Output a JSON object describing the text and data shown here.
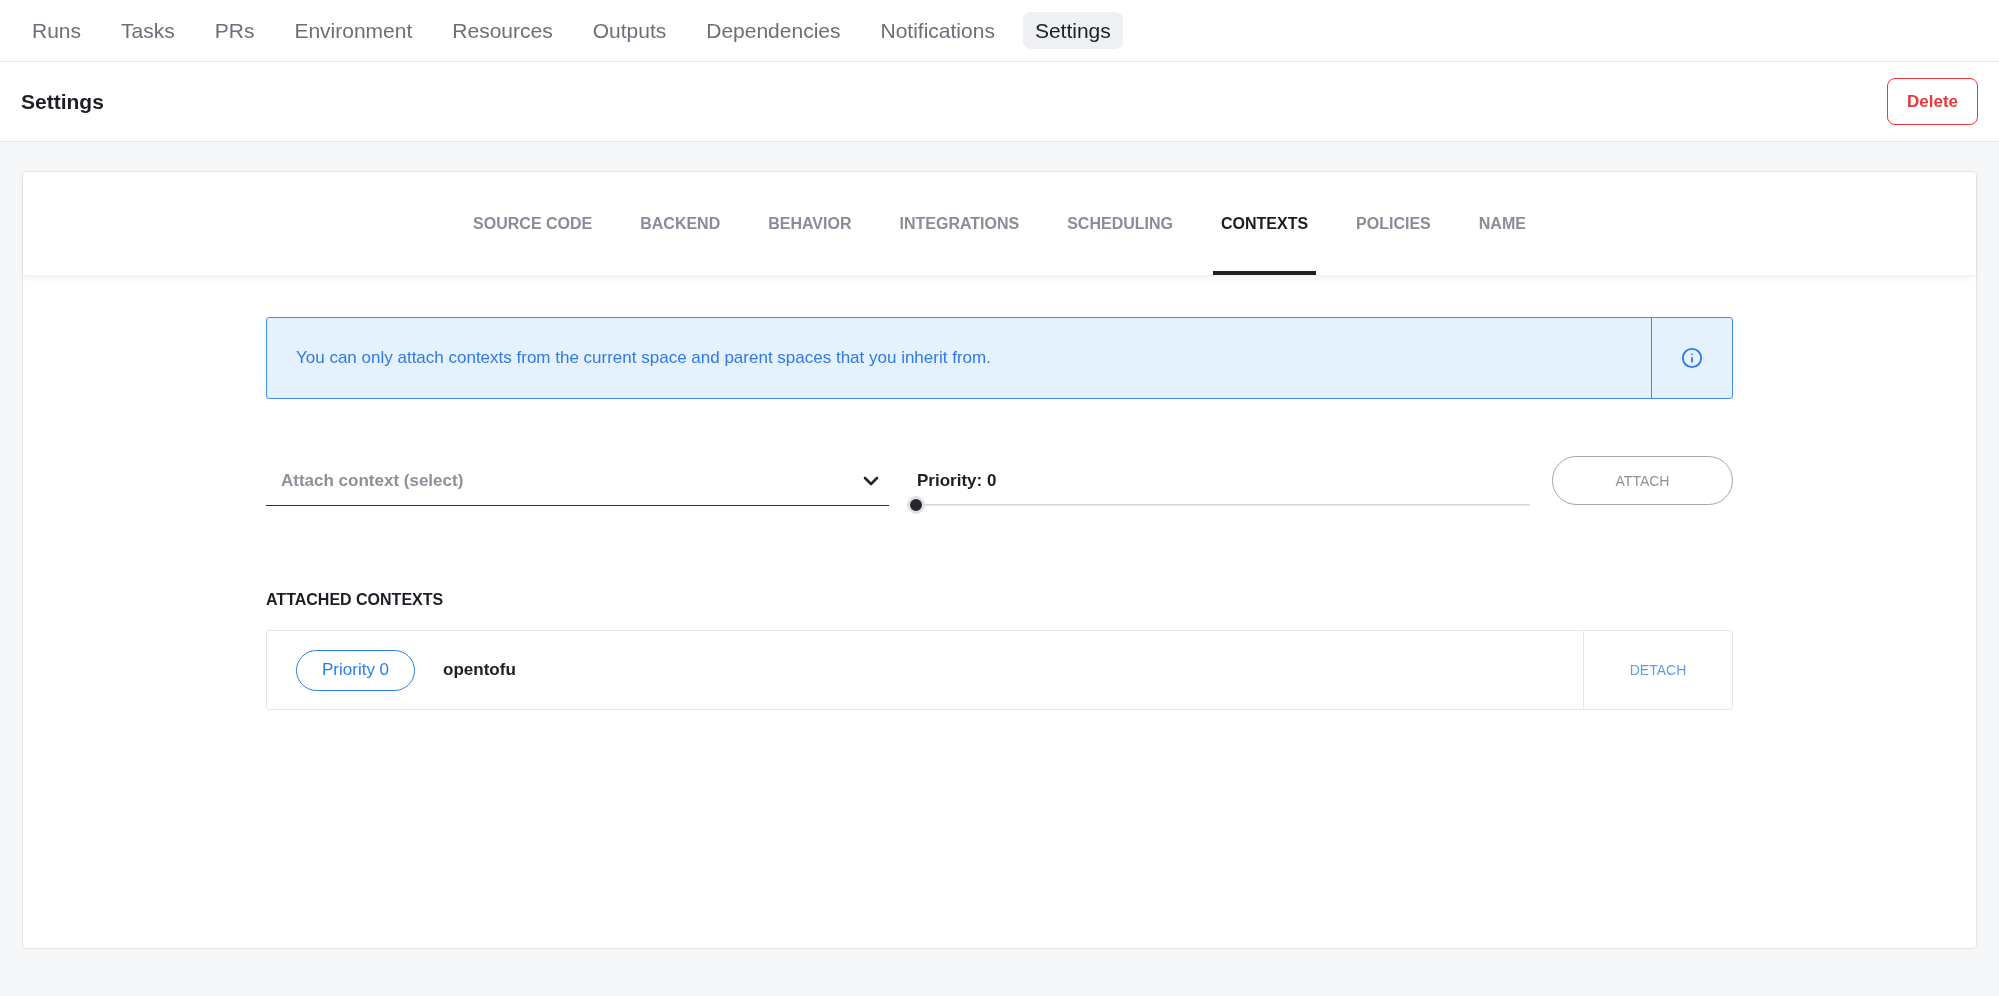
{
  "top_nav": {
    "items": [
      {
        "label": "Runs",
        "selected": false
      },
      {
        "label": "Tasks",
        "selected": false
      },
      {
        "label": "PRs",
        "selected": false
      },
      {
        "label": "Environment",
        "selected": false
      },
      {
        "label": "Resources",
        "selected": false
      },
      {
        "label": "Outputs",
        "selected": false
      },
      {
        "label": "Dependencies",
        "selected": false
      },
      {
        "label": "Notifications",
        "selected": false
      },
      {
        "label": "Settings",
        "selected": true
      }
    ]
  },
  "header": {
    "title": "Settings",
    "delete_button": "Delete"
  },
  "settings_tabs": [
    {
      "label": "SOURCE CODE",
      "selected": false
    },
    {
      "label": "BACKEND",
      "selected": false
    },
    {
      "label": "BEHAVIOR",
      "selected": false
    },
    {
      "label": "INTEGRATIONS",
      "selected": false
    },
    {
      "label": "SCHEDULING",
      "selected": false
    },
    {
      "label": "CONTEXTS",
      "selected": true
    },
    {
      "label": "POLICIES",
      "selected": false
    },
    {
      "label": "NAME",
      "selected": false
    }
  ],
  "info_banner": {
    "text": "You can only attach contexts from the current space and parent spaces that you inherit from."
  },
  "attach_form": {
    "context_select": {
      "placeholder": "Attach context (select)"
    },
    "priority": {
      "label": "Priority: 0",
      "level": 0
    },
    "attach_button": {
      "label": "ATTACH",
      "disabled": true
    }
  },
  "attached_contexts": {
    "title": "ATTACHED CONTEXTS",
    "items": [
      {
        "priority": "Priority 0",
        "name": "opentofu",
        "action": "DETACH"
      }
    ]
  }
}
